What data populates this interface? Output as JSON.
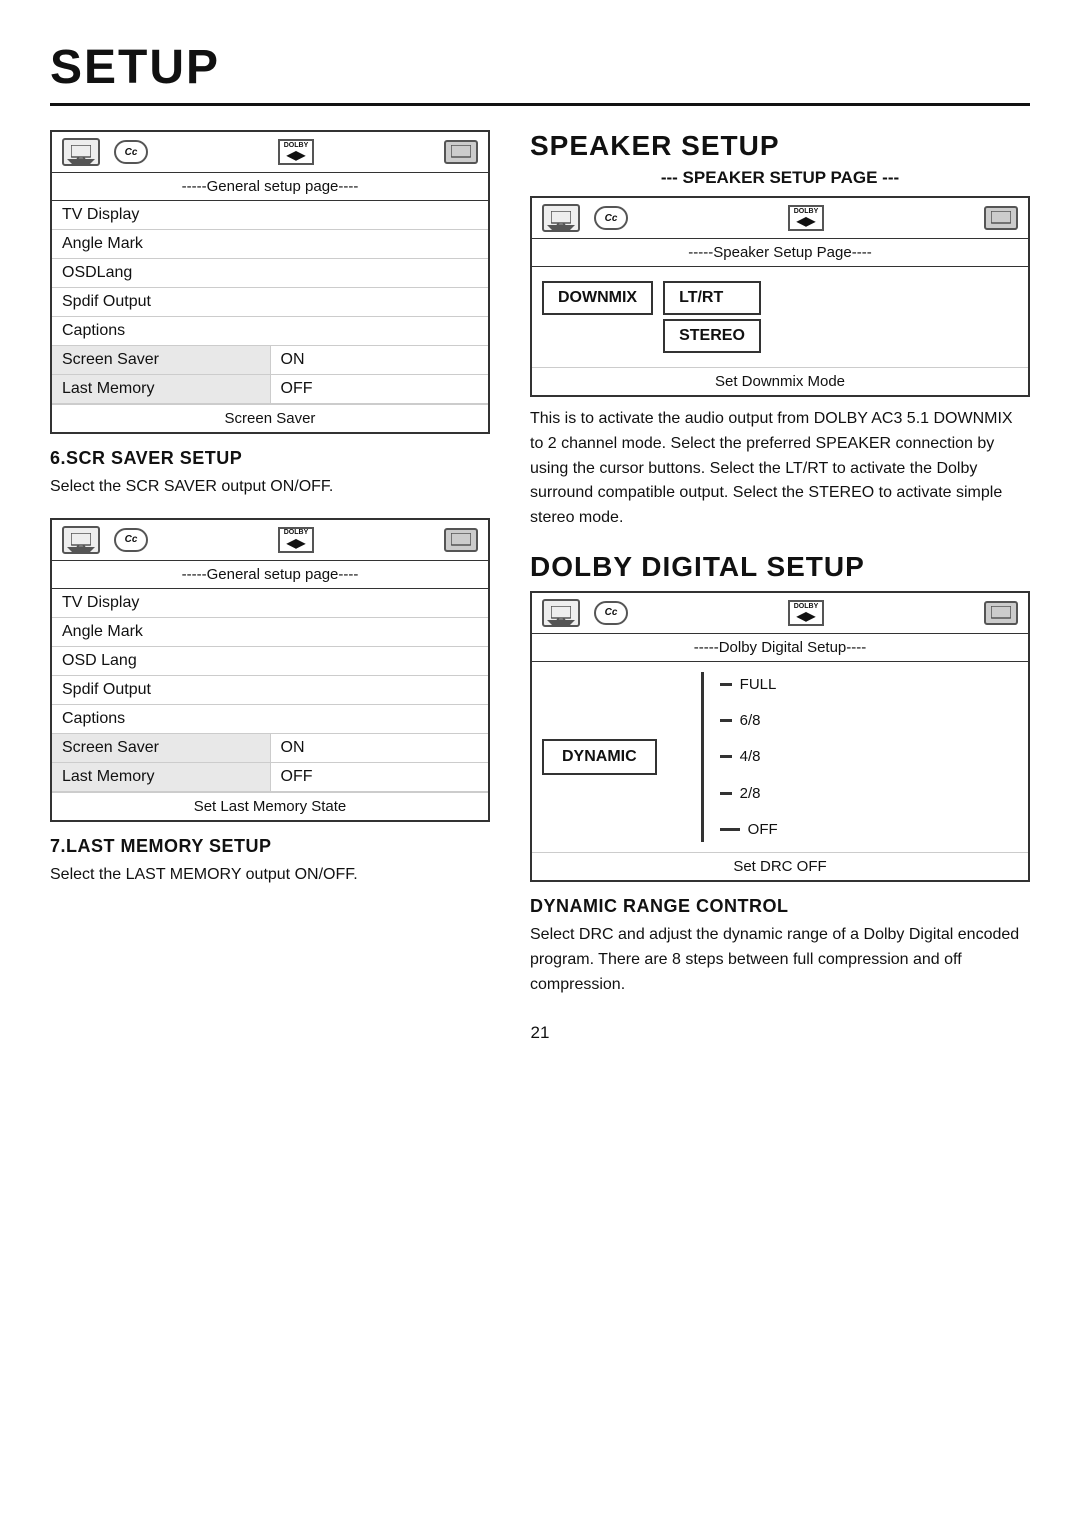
{
  "page": {
    "title": "SETUP",
    "page_number": "21"
  },
  "top_left": {
    "menu1": {
      "header_icons": [
        "tv-icon",
        "cc-icon",
        "dolby-icon",
        "screen-icon"
      ],
      "subtitle": "-----General setup page----",
      "rows": [
        {
          "label": "TV Display",
          "value": null
        },
        {
          "label": "Angle Mark",
          "value": null
        },
        {
          "label": "OSDLang",
          "value": null
        },
        {
          "label": "Spdif Output",
          "value": null
        },
        {
          "label": "Captions",
          "value": null
        },
        {
          "label": "Screen Saver",
          "value": "ON"
        },
        {
          "label": "Last Memory",
          "value": "OFF"
        }
      ],
      "footer": "Screen Saver"
    },
    "scr_saver": {
      "heading": "6.SCR SAVER SETUP",
      "text": "Select the SCR SAVER output ON/OFF."
    },
    "menu2": {
      "header_icons": [
        "tv-icon",
        "cc-icon",
        "dolby-icon",
        "screen-icon"
      ],
      "subtitle": "-----General setup page----",
      "rows": [
        {
          "label": "TV Display",
          "value": null
        },
        {
          "label": "Angle Mark",
          "value": null
        },
        {
          "label": "OSD Lang",
          "value": null
        },
        {
          "label": "Spdif Output",
          "value": null
        },
        {
          "label": "Captions",
          "value": null
        },
        {
          "label": "Screen Saver",
          "value": "ON"
        },
        {
          "label": "Last Memory",
          "value": "OFF"
        }
      ],
      "footer": "Set Last Memory State"
    },
    "last_memory": {
      "heading": "7.LAST MEMORY SETUP",
      "text": "Select the LAST MEMORY output ON/OFF."
    }
  },
  "top_right": {
    "speaker": {
      "title": "SPEAKER SETUP",
      "subtitle": "--- SPEAKER SETUP PAGE ---",
      "menu": {
        "subtitle2": "-----Speaker Setup Page----",
        "downmix_btn": "DOWNMIX",
        "lt_rt_btn": "LT/RT",
        "stereo_btn": "STEREO"
      },
      "footer": "Set Downmix Mode",
      "description": "This is to activate the audio output from DOLBY AC3 5.1 DOWNMIX to 2 channel mode.  Select the preferred SPEAKER connection by using the cursor buttons. Select the LT/RT to activate the Dolby surround compatible output. Select the STEREO to activate simple stereo mode."
    },
    "dolby": {
      "title": "DOLBY DIGITAL SETUP",
      "menu": {
        "subtitle": "-----Dolby Digital Setup----",
        "dynamic_btn": "DYNAMIC",
        "scale": [
          "FULL",
          "6/8",
          "4/8",
          "2/8",
          "OFF"
        ]
      },
      "footer": "Set DRC OFF",
      "drc_heading": "DYNAMIC RANGE CONTROL",
      "drc_text": "Select DRC and adjust the dynamic range of a Dolby Digital encoded program.  There are 8 steps between full compression and off compression."
    }
  }
}
